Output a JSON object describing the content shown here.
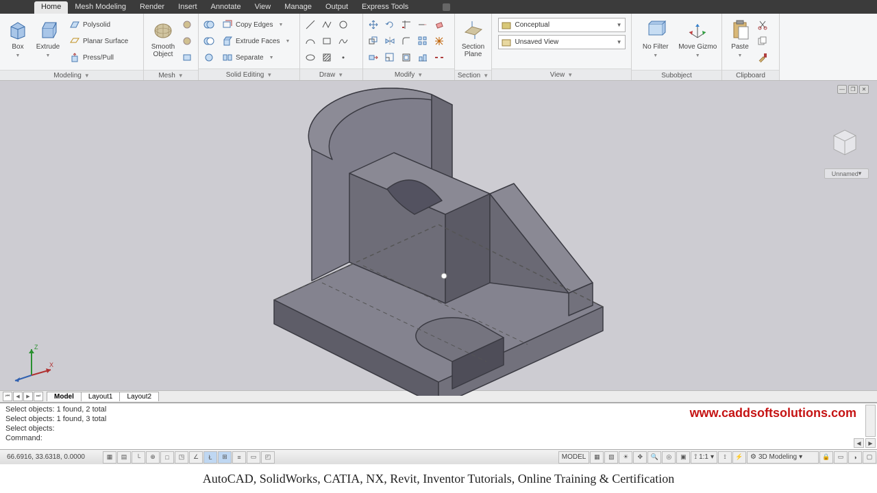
{
  "tabs": {
    "items": [
      "Home",
      "Mesh Modeling",
      "Render",
      "Insert",
      "Annotate",
      "View",
      "Manage",
      "Output",
      "Express Tools"
    ],
    "active": 0
  },
  "ribbon": {
    "modeling": {
      "title": "Modeling",
      "box": "Box",
      "extrude": "Extrude",
      "polysolid": "Polysolid",
      "planar": "Planar Surface",
      "presspull": "Press/Pull"
    },
    "mesh": {
      "title": "Mesh",
      "smooth": "Smooth Object"
    },
    "solidediting": {
      "title": "Solid Editing",
      "copyedges": "Copy Edges",
      "extrudefaces": "Extrude Faces",
      "separate": "Separate"
    },
    "draw": {
      "title": "Draw"
    },
    "modify": {
      "title": "Modify"
    },
    "section": {
      "title": "Section",
      "plane": "Section Plane"
    },
    "view": {
      "title": "View",
      "style": "Conceptual",
      "saved": "Unsaved View"
    },
    "subobject": {
      "title": "Subobject",
      "filter": "No Filter",
      "gizmo": "Move Gizmo"
    },
    "clipboard": {
      "title": "Clipboard",
      "paste": "Paste"
    }
  },
  "viewcube": {
    "label": "Unnamed"
  },
  "modeltabs": {
    "model": "Model",
    "l1": "Layout1",
    "l2": "Layout2"
  },
  "cmd": {
    "line1": "Select objects: 1 found, 2 total",
    "line2": "Select objects: 1 found, 3 total",
    "line3": "Select objects:",
    "line4": "Command:"
  },
  "watermark": "www.caddsoftsolutions.com",
  "status": {
    "coords": "66.6916, 33.6318, 0.0000",
    "model": "MODEL",
    "scale": "1:1",
    "ws": "3D Modeling"
  },
  "footer": "AutoCAD, SolidWorks, CATIA, NX, Revit, Inventor Tutorials, Online Training & Certification"
}
